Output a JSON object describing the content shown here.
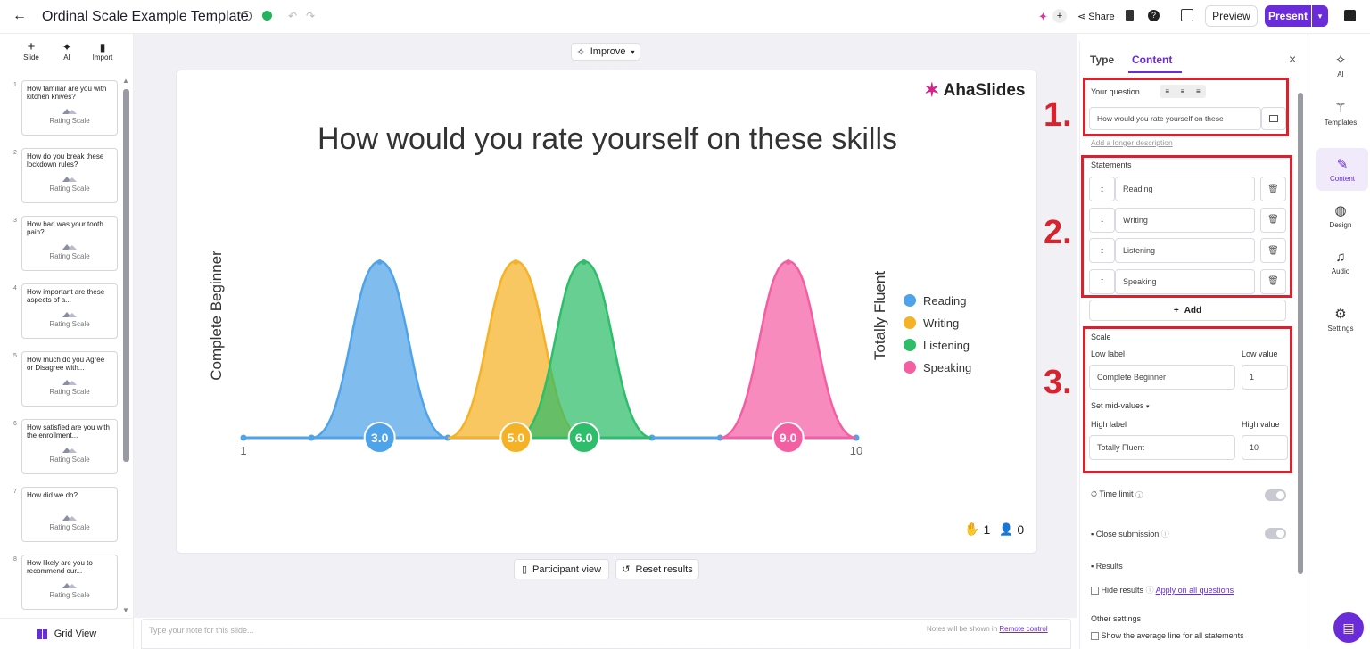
{
  "topbar": {
    "title": "Ordinal Scale Example Template",
    "share": "Share",
    "preview": "Preview",
    "present": "Present"
  },
  "left": {
    "slide_label": "Slide",
    "ai_label": "AI",
    "import_label": "Import",
    "grid_view": "Grid View",
    "slides": [
      {
        "n": "1",
        "q": "How familiar are you with kitchen knives?",
        "type": "Rating Scale"
      },
      {
        "n": "2",
        "q": "How do you break these lockdown rules?",
        "type": "Rating Scale"
      },
      {
        "n": "3",
        "q": "How bad was your tooth pain?",
        "type": "Rating Scale"
      },
      {
        "n": "4",
        "q": "How important are these aspects of a...",
        "type": "Rating Scale"
      },
      {
        "n": "5",
        "q": "How much do you Agree or Disagree with...",
        "type": "Rating Scale"
      },
      {
        "n": "6",
        "q": "How satisfied are you with the enrollment...",
        "type": "Rating Scale"
      },
      {
        "n": "7",
        "q": "How did we do?",
        "type": "Rating Scale"
      },
      {
        "n": "8",
        "q": "How likely are you to recommend our...",
        "type": "Rating Scale"
      }
    ]
  },
  "canvas": {
    "improve": "Improve",
    "brand": "AhaSlides",
    "question": "How would you rate yourself on these skills",
    "participant_view": "Participant view",
    "reset_results": "Reset results",
    "responses": "1",
    "participants": "0",
    "notes_placeholder": "Type your note for this slide...",
    "notes_hint": "Notes will be shown in",
    "notes_link": "Remote control"
  },
  "chart_data": {
    "type": "area",
    "xlabel": "Complete Beginner",
    "ylabel": "Totally Fluent",
    "xlim": [
      1,
      10
    ],
    "x_tick_labels": [
      "1",
      "10"
    ],
    "legend_position": "right",
    "series": [
      {
        "name": "Reading",
        "color": "#4fa3e8",
        "value": 3.0,
        "label": "3.0"
      },
      {
        "name": "Writing",
        "color": "#f5b225",
        "value": 5.0,
        "label": "5.0"
      },
      {
        "name": "Listening",
        "color": "#2ebd6a",
        "value": 6.0,
        "label": "6.0"
      },
      {
        "name": "Speaking",
        "color": "#f45ea3",
        "value": 9.0,
        "label": "9.0"
      }
    ]
  },
  "panel": {
    "tab_type": "Type",
    "tab_content": "Content",
    "your_question": "Your question",
    "question_value": "How would you rate yourself on these",
    "add_description": "Add a longer description",
    "statements_label": "Statements",
    "statements": [
      "Reading",
      "Writing",
      "Listening",
      "Speaking"
    ],
    "add": "Add",
    "scale": "Scale",
    "low_label": "Low label",
    "low_value_label": "Low value",
    "low_label_value": "Complete Beginner",
    "low_value": "1",
    "mid_values": "Set mid-values",
    "high_label": "High label",
    "high_value_label": "High value",
    "high_label_value": "Totally Fluent",
    "high_value": "10",
    "time_limit": "Time limit",
    "close_submission": "Close submission",
    "results": "Results",
    "hide_results": "Hide results",
    "apply_all": "Apply on all questions",
    "other_settings": "Other settings",
    "show_average": "Show the average line for all statements",
    "annot": [
      "1.",
      "2.",
      "3."
    ]
  },
  "rail": {
    "ai": "AI",
    "templates": "Templates",
    "content": "Content",
    "design": "Design",
    "audio": "Audio",
    "settings": "Settings"
  },
  "colors": {
    "accent": "#6a2bd9",
    "annotation": "#d8232f"
  }
}
